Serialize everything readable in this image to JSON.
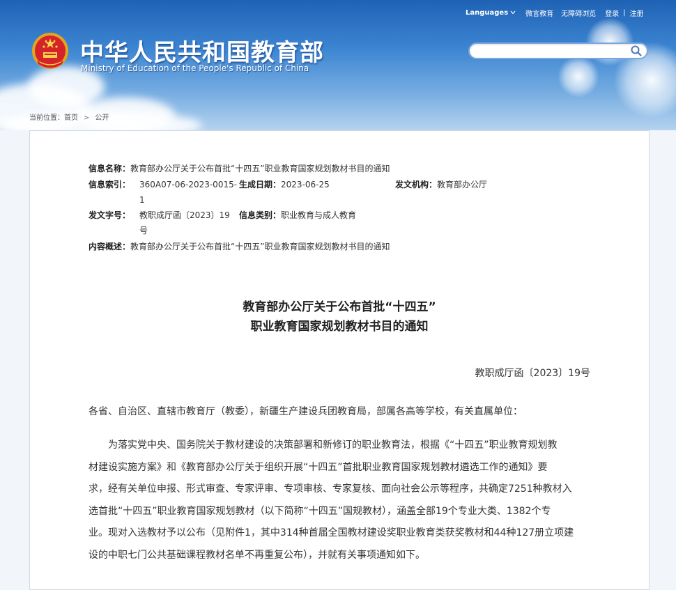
{
  "header": {
    "nav": {
      "languages": "Languages",
      "weibo": "微言教育",
      "accessible": "无障碍浏览",
      "login": "登录",
      "separator": "|",
      "register": "注册"
    },
    "site_name_cn": "中华人民共和国教育部",
    "site_name_en": "Ministry of Education of the People's Republic of China",
    "search": {
      "placeholder": ""
    },
    "icons": {
      "emblem": "national-emblem-icon",
      "search": "search-icon",
      "chevron": "chevron-down-icon"
    },
    "colors": {
      "banner_top": "#1f62b5",
      "banner_bottom": "#b5d3ef"
    }
  },
  "breadcrumb": {
    "label": "当前位置：",
    "home": "首页",
    "separator": ">",
    "current": "公开"
  },
  "info": {
    "name_label": "信息名称：",
    "name_value": "教育部办公厅关于公布首批“十四五”职业教育国家规划教材书目的通知",
    "index_label": "信息索引：",
    "index_value_line1": "360A07-06-2023-0015-",
    "index_value_line2": "1",
    "date_label": "生成日期：",
    "date_value": "2023-06-25",
    "issuer_label": "发文机构：",
    "issuer_value": "教育部办公厅",
    "docno_label": "发文字号：",
    "docno_value_line1": "教职成厅函〔2023〕19",
    "docno_value_line2": "号",
    "category_label": "信息类别：",
    "category_value": "职业教育与成人教育",
    "summary_label": "内容概述：",
    "summary_value": "教育部办公厅关于公布首批“十四五”职业教育国家规划教材书目的通知"
  },
  "article": {
    "title_line1": "教育部办公厅关于公布首批“十四五”",
    "title_line2": "职业教育国家规划教材书目的通知",
    "doc_number": "教职成厅函〔2023〕19号",
    "salutation": "各省、自治区、直辖市教育厅（教委），新疆生产建设兵团教育局，部属各高等学校，有关直属单位：",
    "body_lines": [
      "为落实党中央、国务院关于教材建设的决策部署和新修订的职业教育法，根据《“十四五”职业教育规划教",
      "材建设实施方案》和《教育部办公厅关于组织开展“十四五”首批职业教育国家规划教材遴选工作的通知》要",
      "求，经有关单位申报、形式审查、专家评审、专项审核、专家复核、面向社会公示等程序，共确定7251种教材入",
      "选首批“十四五”职业教育国家规划教材（以下简称“十四五”国规教材），涵盖全部19个专业大类、1382个专",
      "业。现对入选教材予以公布（见附件1，其中314种首届全国教材建设奖职业教育类获奖教材和44种127册立项建",
      "设的中职七门公共基础课程教材名单不再重复公布），并就有关事项通知如下。"
    ]
  }
}
